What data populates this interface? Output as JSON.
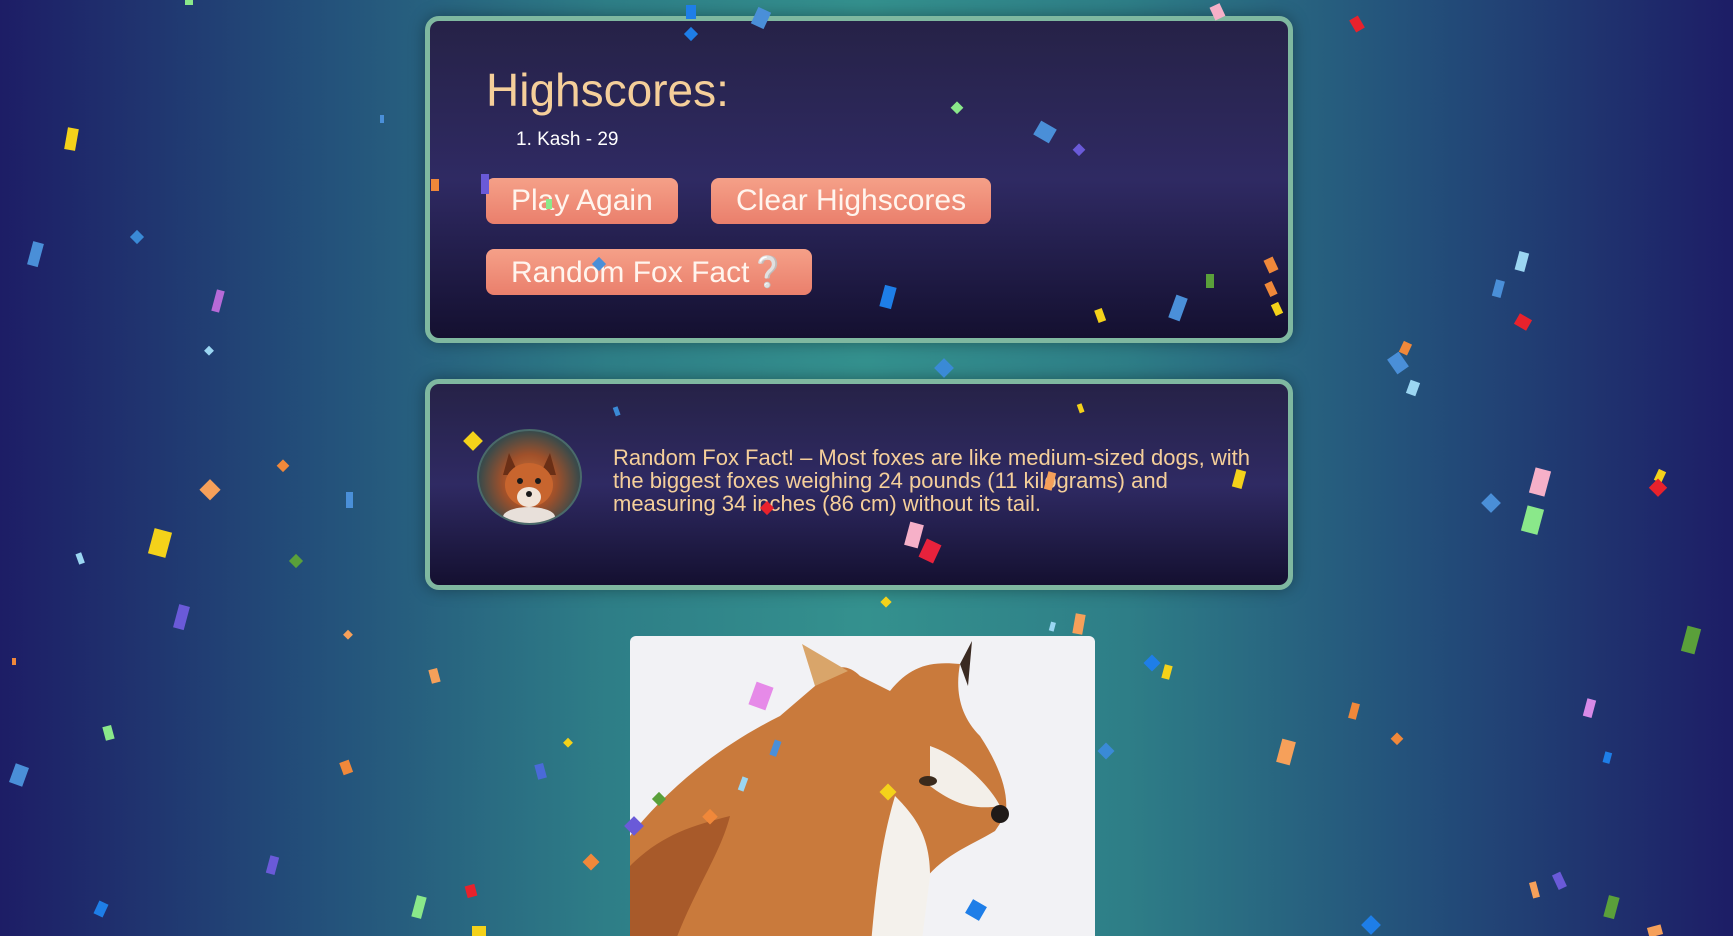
{
  "highscores": {
    "title": "Highscores:",
    "entries": [
      "1. Kash - 29"
    ]
  },
  "buttons": {
    "play_again": "Play Again",
    "clear_highscores": "Clear Highscores",
    "random_fox_fact": "Random Fox Fact❔"
  },
  "fact": {
    "text": "Random Fox Fact! – Most foxes are like medium-sized dogs, with the biggest foxes weighing 24 pounds (11 kilograms) and measuring 34 inches (86 cm) without its tail."
  },
  "colors": {
    "accent_text": "#f5cf9a",
    "button": "#ee8c77",
    "panel_border": "#7fb8a0"
  }
}
